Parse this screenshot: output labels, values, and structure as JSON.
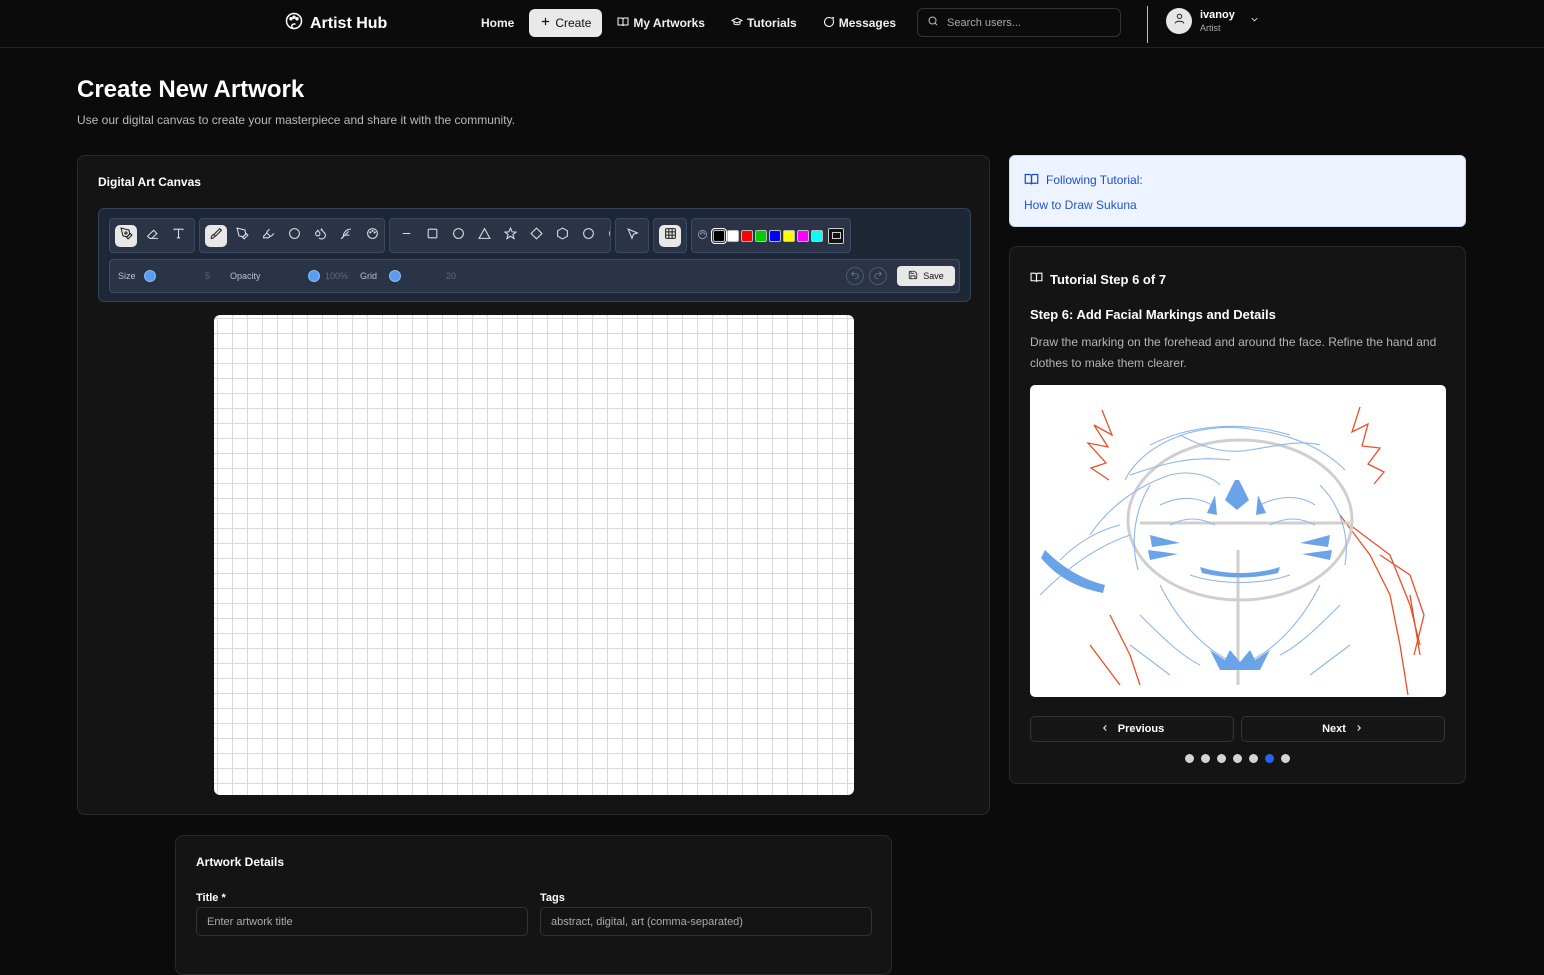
{
  "app": {
    "name": "Artist Hub"
  },
  "nav": {
    "links": [
      {
        "label": "Home",
        "icon": ""
      },
      {
        "label": "Create",
        "icon": "plus-icon",
        "active": true
      },
      {
        "label": "My Artworks",
        "icon": "book-icon"
      },
      {
        "label": "Tutorials",
        "icon": "graduation-cap-icon"
      },
      {
        "label": "Messages",
        "icon": "message-icon"
      }
    ],
    "search_placeholder": "Search users..."
  },
  "user": {
    "name": "ivanoy",
    "role": "Artist"
  },
  "page": {
    "title": "Create New Artwork",
    "subtitle": "Use our digital canvas to create your masterpiece and share it with the community."
  },
  "canvas": {
    "title": "Digital Art Canvas",
    "tool_groups": [
      [
        "pen-icon",
        "eraser-icon",
        "text-icon"
      ],
      [
        "brush-icon",
        "pencil-icon",
        "marker-icon",
        "circle-brush-icon",
        "drops-icon",
        "feather-icon",
        "palette-icon"
      ],
      [
        "line-icon",
        "square-icon",
        "circle-icon",
        "triangle-icon",
        "star-icon",
        "diamond-icon",
        "hexagon-icon",
        "octagon-icon",
        "moon-icon"
      ],
      [
        "select-icon"
      ],
      [
        "grid-icon"
      ]
    ],
    "colors": [
      "#000000",
      "#ffffff",
      "#ff0000",
      "#00cc00",
      "#0000ff",
      "#ffff00",
      "#ff00ff",
      "#00ffff"
    ],
    "selected_color": "#000000",
    "settings": {
      "size_label": "Size",
      "size_value": "5",
      "opacity_label": "Opacity",
      "opacity_value": "100%",
      "grid_label": "Grid",
      "grid_value": "20"
    },
    "save_label": "Save"
  },
  "details": {
    "title": "Artwork Details",
    "title_label": "Title *",
    "title_placeholder": "Enter artwork title",
    "tags_label": "Tags",
    "tags_placeholder": "abstract, digital, art (comma-separated)"
  },
  "following": {
    "label": "Following Tutorial:",
    "tutorial": "How to Draw Sukuna"
  },
  "tutorial_step": {
    "header": "Tutorial Step 6 of 7",
    "title": "Step 6: Add Facial Markings and Details",
    "description": "Draw the marking on the forehead and around the face. Refine the hand and clothes to make them clearer.",
    "prev_label": "Previous",
    "next_label": "Next",
    "current": 6,
    "total": 7
  }
}
